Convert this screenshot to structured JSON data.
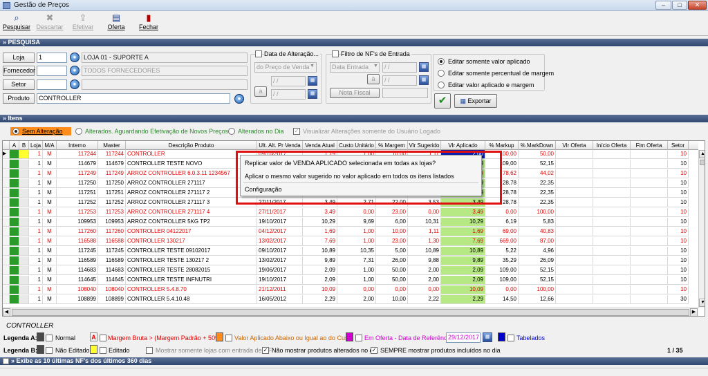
{
  "window": {
    "title": "Gestão de Preços"
  },
  "toolbar": [
    {
      "label": "Pesquisar",
      "icon": "binoculars-icon",
      "enabled": true
    },
    {
      "label": "Descartar",
      "icon": "discard-x-icon",
      "enabled": false
    },
    {
      "label": "Efetivar",
      "icon": "apply-icon",
      "enabled": false
    },
    {
      "label": "Oferta",
      "icon": "offer-icon",
      "enabled": true
    },
    {
      "label": "Fechar",
      "icon": "close-door-icon",
      "enabled": true
    }
  ],
  "sections": {
    "search": "» PESQUISA",
    "items": "» Itens",
    "footer": "» Exibe as 10 últimas NF's dos últimos 360 dias"
  },
  "search": {
    "loja_label": "Loja",
    "loja_value": "1",
    "loja_desc": "LOJA 01 - SUPORTE A",
    "fornecedor_label": "Fornecedor",
    "fornecedor_desc": "TODOS FORNECEDORES",
    "setor_label": "Setor",
    "produto_label": "Produto",
    "produto_value": "CONTROLLER"
  },
  "alteracao": {
    "label": "Data de Alteração...",
    "select": "do Preço de Venda",
    "date": "/ /",
    "a_label": "à",
    "date2": "/ /"
  },
  "nf": {
    "label": "Filtro de NF's de Entrada",
    "select": "Data Entrada",
    "date": "/ /",
    "a_label": "à",
    "date2": "/ /",
    "nota_label": "Nota Fiscal"
  },
  "edit_options": [
    "Editar somente valor aplicado",
    "Editar somente percentual de margem",
    "Editar valor aplicado e margem"
  ],
  "export_label": "Exportar",
  "filters": {
    "sem": "Sem Alteração",
    "alterados": "Alterados. Aguardando Efetivação de Novos Preços",
    "alterados_dia": "Alterados no Dia",
    "visualizar": "Visualizar Alterações somente do Usuário Logado"
  },
  "columns": [
    "A",
    "B",
    "Loja",
    "M/A",
    "Interno",
    "Master",
    "Descrição Produto",
    "Ult. Alt. Pr Venda",
    "Venda Atual",
    "Custo Unitário",
    "% Margem",
    "Vlr Sugerido",
    "Vlr Aplicado",
    "% Markup",
    "% MarkDown",
    "Vlr Oferta",
    "Início Oferta",
    "Fim Oferta",
    "Setor"
  ],
  "rows": [
    {
      "loja": "1",
      "ma": "M",
      "interno": "117244",
      "master": "117244",
      "desc": "CONTROLLER",
      "data": "09/10/2017",
      "venda": "1,19",
      "custo": "1,00",
      "margem": "10,00",
      "sugerido": "1,11",
      "aplicado": "2,00",
      "markup": "100,00",
      "markdown": "50,00",
      "setor": "10",
      "red": true
    },
    {
      "loja": "1",
      "ma": "M",
      "interno": "114679",
      "master": "114679",
      "desc": "CONTROLLER TESTE NOVO",
      "data": "",
      "venda": "",
      "custo": "",
      "margem": "",
      "sugerido": "",
      "aplicado": "2,09",
      "markup": "109,00",
      "markdown": "52,15",
      "setor": "10",
      "red": false
    },
    {
      "loja": "1",
      "ma": "M",
      "interno": "117249",
      "master": "117249",
      "desc": "ARROZ CONTROLLER 6.0.3.11 1234567",
      "data": "",
      "venda": "",
      "custo": "",
      "margem": "",
      "sugerido": "",
      "aplicado": "2,59",
      "markup": "78,62",
      "markdown": "44,02",
      "setor": "10",
      "red": true
    },
    {
      "loja": "1",
      "ma": "M",
      "interno": "117250",
      "master": "117250",
      "desc": "ARROZ CONTROLLER 271117",
      "data": "",
      "venda": "",
      "custo": "",
      "margem": "",
      "sugerido": "",
      "aplicado": "3,49",
      "markup": "28,78",
      "markdown": "22,35",
      "setor": "10",
      "red": false
    },
    {
      "loja": "1",
      "ma": "M",
      "interno": "117251",
      "master": "117251",
      "desc": "ARROZ CONTROLLER 271117 2",
      "data": "",
      "venda": "",
      "custo": "",
      "margem": "",
      "sugerido": "",
      "aplicado": "3,49",
      "markup": "28,78",
      "markdown": "22,35",
      "setor": "10",
      "red": false
    },
    {
      "loja": "1",
      "ma": "M",
      "interno": "117252",
      "master": "117252",
      "desc": "ARROZ CONTROLLER 271117 3",
      "data": "27/11/2017",
      "venda": "3,49",
      "custo": "2,71",
      "margem": "22,00",
      "sugerido": "3,53",
      "aplicado": "3,49",
      "markup": "28,78",
      "markdown": "22,35",
      "setor": "10",
      "red": false
    },
    {
      "loja": "1",
      "ma": "M",
      "interno": "117253",
      "master": "117253",
      "desc": "ARROZ CONTROLLER 271117 4",
      "data": "27/11/2017",
      "venda": "3,49",
      "custo": "0,00",
      "margem": "23,00",
      "sugerido": "0,00",
      "aplicado": "3,49",
      "markup": "0,00",
      "markdown": "100,00",
      "setor": "10",
      "red": true
    },
    {
      "loja": "1",
      "ma": "M",
      "interno": "109953",
      "master": "109953",
      "desc": "ARROZ CONTROLLER 5KG TP2",
      "data": "19/10/2017",
      "venda": "10,29",
      "custo": "9,69",
      "margem": "6,00",
      "sugerido": "10,31",
      "aplicado": "10,29",
      "markup": "6,19",
      "markdown": "5,83",
      "setor": "10",
      "red": false
    },
    {
      "loja": "1",
      "ma": "M",
      "interno": "117260",
      "master": "117260",
      "desc": "CONTROLLER 04122017",
      "data": "04/12/2017",
      "venda": "1,69",
      "custo": "1,00",
      "margem": "10,00",
      "sugerido": "1,11",
      "aplicado": "1,69",
      "markup": "69,00",
      "markdown": "40,83",
      "setor": "10",
      "red": true
    },
    {
      "loja": "1",
      "ma": "M",
      "interno": "116588",
      "master": "116588",
      "desc": "CONTROLLER 130217",
      "data": "13/02/2017",
      "venda": "7,69",
      "custo": "1,00",
      "margem": "23,00",
      "sugerido": "1,30",
      "aplicado": "7,69",
      "markup": "669,00",
      "markdown": "87,00",
      "setor": "10",
      "red": true
    },
    {
      "loja": "1",
      "ma": "M",
      "interno": "117245",
      "master": "117245",
      "desc": "CONTROLLER TESTE 09102017",
      "data": "09/10/2017",
      "venda": "10,89",
      "custo": "10,35",
      "margem": "5,00",
      "sugerido": "10,89",
      "aplicado": "10,89",
      "markup": "5,22",
      "markdown": "4,96",
      "setor": "10",
      "red": false
    },
    {
      "loja": "1",
      "ma": "M",
      "interno": "116589",
      "master": "116589",
      "desc": "CONTROLLER TESTE 130217 2",
      "data": "13/02/2017",
      "venda": "9,89",
      "custo": "7,31",
      "margem": "26,00",
      "sugerido": "9,88",
      "aplicado": "9,89",
      "markup": "35,29",
      "markdown": "26,09",
      "setor": "10",
      "red": false
    },
    {
      "loja": "1",
      "ma": "M",
      "interno": "114683",
      "master": "114683",
      "desc": "CONTROLLER TESTE 28082015",
      "data": "19/06/2017",
      "venda": "2,09",
      "custo": "1,00",
      "margem": "50,00",
      "sugerido": "2,00",
      "aplicado": "2,09",
      "markup": "109,00",
      "markdown": "52,15",
      "setor": "10",
      "red": false
    },
    {
      "loja": "1",
      "ma": "M",
      "interno": "114645",
      "master": "114645",
      "desc": "CONTROLLER TESTE INFNUTRI",
      "data": "19/10/2017",
      "venda": "2,09",
      "custo": "1,00",
      "margem": "50,00",
      "sugerido": "2,00",
      "aplicado": "2,09",
      "markup": "109,00",
      "markdown": "52,15",
      "setor": "10",
      "red": false
    },
    {
      "loja": "1",
      "ma": "M",
      "interno": "108040",
      "master": "108040",
      "desc": "CONTROLLER 5.4.8.70",
      "data": "21/12/2011",
      "venda": "10,09",
      "custo": "0,00",
      "margem": "0,00",
      "sugerido": "0,00",
      "aplicado": "10,09",
      "markup": "0,00",
      "markdown": "100,00",
      "setor": "10",
      "red": true
    },
    {
      "loja": "1",
      "ma": "M",
      "interno": "108899",
      "master": "108899",
      "desc": "CONTROLLER 5.4.10.48",
      "data": "16/05/2012",
      "venda": "2,29",
      "custo": "2,00",
      "margem": "10,00",
      "sugerido": "2,22",
      "aplicado": "2,29",
      "markup": "14,50",
      "markdown": "12,66",
      "setor": "30",
      "red": false
    }
  ],
  "context_menu": [
    "Replicar valor de VENDA APLICADO selecionada em todas as lojas?",
    "Aplicar o mesmo valor sugerido no valor aplicado em todos os itens listados",
    "Configuração"
  ],
  "status": {
    "product": "CONTROLLER",
    "page": "1 / 35"
  },
  "legend": {
    "a_label": "Legenda A:",
    "b_label": "Legenda B:",
    "normal": "Normal",
    "nao_editado": "Não Editado",
    "editado": "Editado",
    "margem": "Margem Bruta > (Margem Padrão + 50%)",
    "valor_abaixo": "Valor Aplicado Abaixo ou Igual ao do Custo",
    "oferta": "Em Oferta - Data de Referência",
    "oferta_date": "29/12/2017",
    "tabelados": "Tabelados",
    "a_marker": "A",
    "mostrar": "Mostrar somente lojas com entrada de NF",
    "nao_mostrar": "Não mostrar produtos alterados no dia",
    "sempre": "SEMPRE mostrar produtos incluídos no dia"
  },
  "colors": {
    "green_cell": "#b6e884",
    "dark_cell": "#2a9a2a",
    "yellow_cell": "#ffff30",
    "orange": "#ff8c1a",
    "red_text": "#e00000",
    "magenta": "#d000d0",
    "blue": "#0000cc",
    "selected_blue": "#0a1fb0"
  }
}
